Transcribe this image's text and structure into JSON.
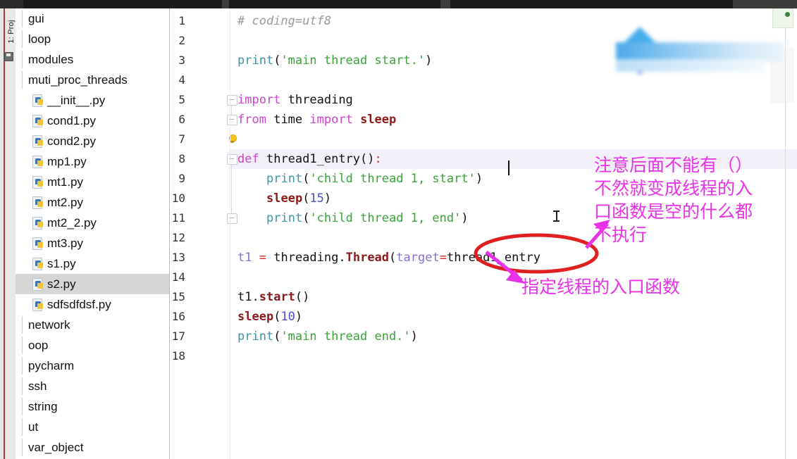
{
  "window": {
    "tool_tab_label": "1: Proj"
  },
  "sidebar": {
    "items": [
      {
        "label": "gui",
        "type": "folder",
        "selected": false
      },
      {
        "label": "loop",
        "type": "folder",
        "selected": false
      },
      {
        "label": "modules",
        "type": "folder",
        "selected": false
      },
      {
        "label": "muti_proc_threads",
        "type": "folder",
        "selected": false
      },
      {
        "label": "__init__.py",
        "type": "python",
        "selected": false
      },
      {
        "label": "cond1.py",
        "type": "python",
        "selected": false
      },
      {
        "label": "cond2.py",
        "type": "python",
        "selected": false
      },
      {
        "label": "mp1.py",
        "type": "python",
        "selected": false
      },
      {
        "label": "mt1.py",
        "type": "python",
        "selected": false
      },
      {
        "label": "mt2.py",
        "type": "python",
        "selected": false
      },
      {
        "label": "mt2_2.py",
        "type": "python",
        "selected": false
      },
      {
        "label": "mt3.py",
        "type": "python",
        "selected": false
      },
      {
        "label": "s1.py",
        "type": "python",
        "selected": false
      },
      {
        "label": "s2.py",
        "type": "python",
        "selected": true
      },
      {
        "label": "sdfsdfdsf.py",
        "type": "python",
        "selected": false
      },
      {
        "label": "network",
        "type": "folder",
        "selected": false
      },
      {
        "label": "oop",
        "type": "folder",
        "selected": false
      },
      {
        "label": "pycharm",
        "type": "folder",
        "selected": false
      },
      {
        "label": "ssh",
        "type": "folder",
        "selected": false
      },
      {
        "label": "string",
        "type": "folder",
        "selected": false
      },
      {
        "label": "ut",
        "type": "folder",
        "selected": false
      },
      {
        "label": "var_object",
        "type": "folder",
        "selected": false
      }
    ]
  },
  "editor": {
    "line_numbers": [
      "1",
      "2",
      "3",
      "4",
      "5",
      "6",
      "7",
      "8",
      "9",
      "10",
      "11",
      "12",
      "13",
      "14",
      "15",
      "16",
      "17",
      "18"
    ],
    "caret_line": 8,
    "lines": [
      {
        "n": 1,
        "text": "# coding=utf8"
      },
      {
        "n": 2,
        "text": ""
      },
      {
        "n": 3,
        "text": "print('main thread start.')"
      },
      {
        "n": 4,
        "text": ""
      },
      {
        "n": 5,
        "text": "import threading"
      },
      {
        "n": 6,
        "text": "from time import sleep"
      },
      {
        "n": 7,
        "text": ""
      },
      {
        "n": 8,
        "text": "def thread1_entry():"
      },
      {
        "n": 9,
        "text": "    print('child thread 1, start')"
      },
      {
        "n": 10,
        "text": "    sleep(15)"
      },
      {
        "n": 11,
        "text": "    print('child thread 1, end')"
      },
      {
        "n": 12,
        "text": ""
      },
      {
        "n": 13,
        "text": "t1 = threading.Thread(target=thread1_entry"
      },
      {
        "n": 14,
        "text": ""
      },
      {
        "n": 15,
        "text": "t1.start()"
      },
      {
        "n": 16,
        "text": "sleep(10)"
      },
      {
        "n": 17,
        "text": "print('main thread end.')"
      },
      {
        "n": 18,
        "text": ""
      }
    ]
  },
  "annotations": {
    "note_right": "注意后面不能有（）\n不然就变成线程的入\n口函数是空的什么都\n不执行",
    "note_bottom": "指定线程的入口函数",
    "circled_text": "thread1_entry",
    "color": "#e832e8",
    "ellipse_color": "#e02020"
  },
  "colors": {
    "keyword": "#cc44cc",
    "string": "#39a339",
    "function": "#3e93a8",
    "number": "#4a4ad4",
    "builtin": "#8b1a1a",
    "comment": "#9a9a9a",
    "kwarg": "#8a6fd4",
    "selection": "#d6d6d6",
    "caret_line": "#f3f0fa"
  }
}
